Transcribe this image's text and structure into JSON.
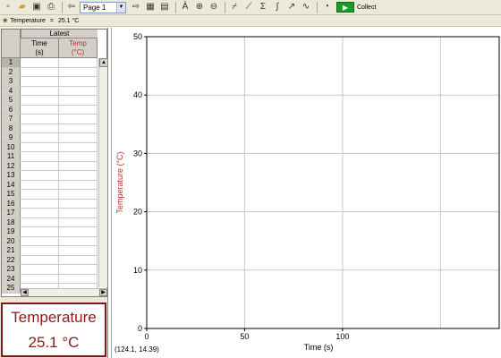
{
  "toolbar": {
    "page_select": "Page 1",
    "collect_label": "Collect"
  },
  "status": {
    "sensor": "Temperature",
    "eq": "=",
    "reading": "25.1 °C"
  },
  "table": {
    "group_header": "Latest",
    "col_time": "Time\n(s)",
    "col_time_line1": "Time",
    "col_time_line2": "(s)",
    "col_temp_line1": "Temp",
    "col_temp_line2": "(°C)",
    "rows": [
      "1",
      "2",
      "3",
      "4",
      "5",
      "6",
      "7",
      "8",
      "9",
      "10",
      "11",
      "12",
      "13",
      "14",
      "15",
      "16",
      "17",
      "18",
      "19",
      "20",
      "21",
      "22",
      "23",
      "24",
      "25"
    ]
  },
  "meter": {
    "name": "Temperature",
    "value": "25.1 °C"
  },
  "graph": {
    "coord_readout": "(124.1, 14.39)"
  },
  "chart_data": {
    "type": "line",
    "xlabel": "Time (s)",
    "ylabel": "Temperature (°C)",
    "xlim": [
      0,
      180
    ],
    "ylim": [
      0,
      50
    ],
    "x_ticks": [
      "0",
      "50",
      "100"
    ],
    "y_ticks": [
      "0",
      "10",
      "20",
      "30",
      "40",
      "50"
    ],
    "grid": true,
    "series": [],
    "colors": {
      "ylabel": "#b33030"
    }
  }
}
